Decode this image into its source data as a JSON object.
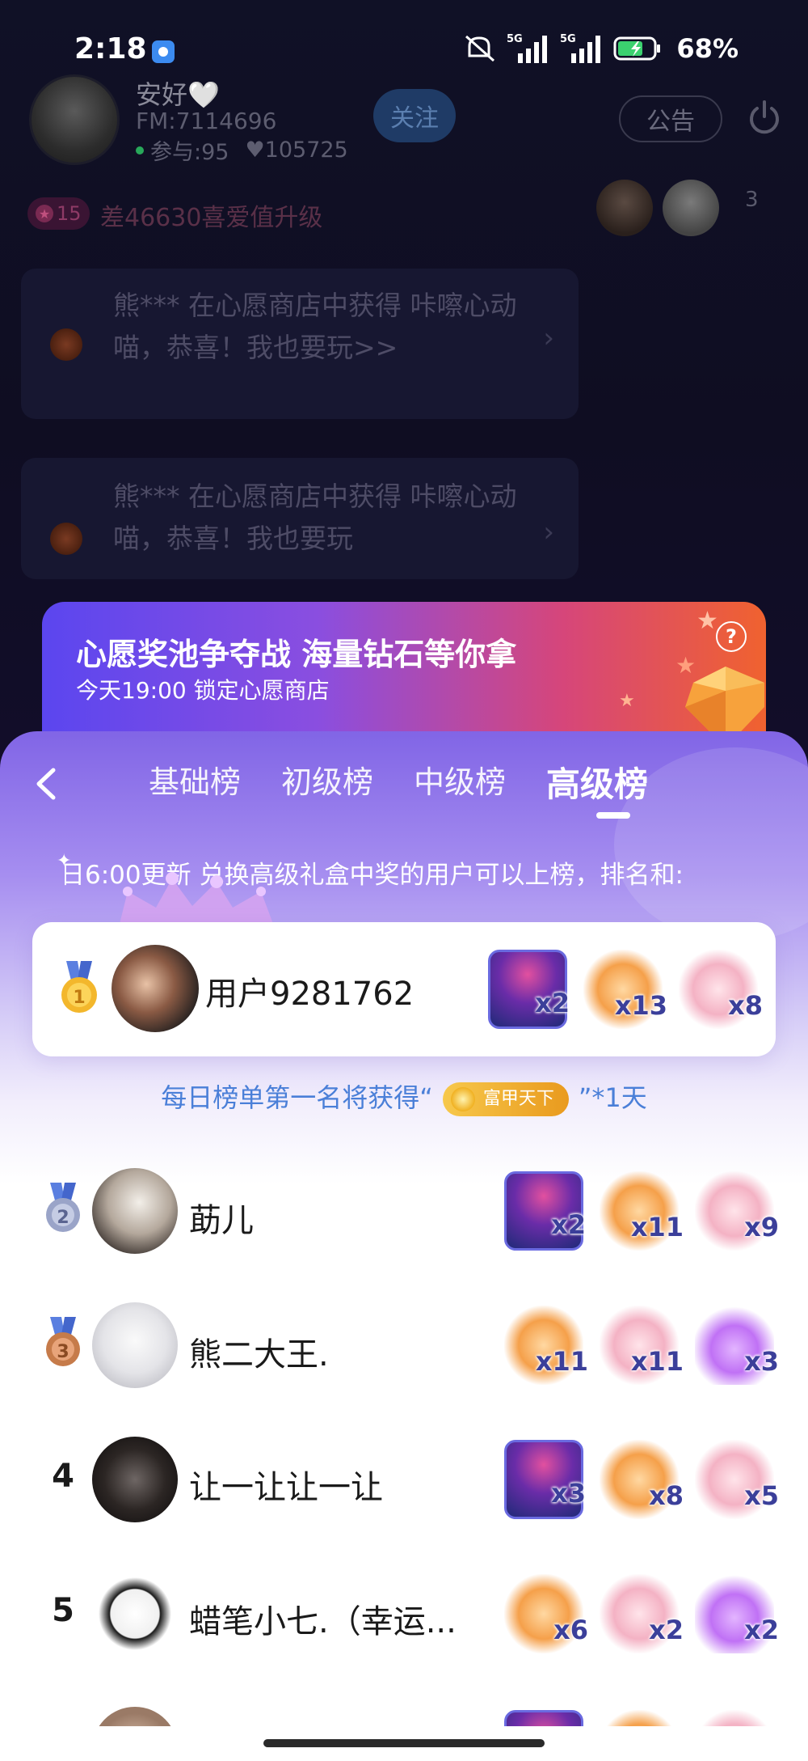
{
  "status_bar": {
    "time": "2:18",
    "network_1": "5G",
    "network_2": "5G",
    "battery": "68%"
  },
  "room": {
    "host_name": "安好🤍",
    "host_fm": "FM:7114696",
    "host_participants": "参与:95",
    "host_likes": "♥105725",
    "follow_label": "关注",
    "notice_label": "公告",
    "level_number": "15",
    "level_text": "差46630喜爱值升级",
    "audience_count": "3",
    "messages": [
      {
        "text": "熊*** 在心愿商店中获得 咔嚓心动喵，恭喜！我也要玩>>"
      },
      {
        "text": "熊*** 在心愿商店中获得 咔嚓心动喵，恭喜！我也要玩"
      }
    ]
  },
  "promo": {
    "title": "心愿奖池争夺战 海量钻石等你拿",
    "subtitle": "今天19:00 锁定心愿商店",
    "help": "?"
  },
  "leaderboard": {
    "tabs": [
      {
        "label": "基础榜",
        "active": false
      },
      {
        "label": "初级榜",
        "active": false
      },
      {
        "label": "中级榜",
        "active": false
      },
      {
        "label": "高级榜",
        "active": true
      }
    ],
    "ticker": "日6:00更新 兑换高级礼盒中奖的用户可以上榜，排名和:",
    "reward_prefix": "每日榜单第一名将获得“",
    "reward_badge": "富甲天下",
    "reward_suffix": "”*1天",
    "entries": [
      {
        "rank": "1",
        "name": "用户9281762",
        "medal": "gold",
        "gifts": [
          {
            "icon": "dj-girl",
            "count": "x2"
          },
          {
            "icon": "camera-cat",
            "count": "x13"
          },
          {
            "icon": "angel-bear",
            "count": "x8"
          }
        ]
      },
      {
        "rank": "2",
        "name": "莇儿",
        "medal": "silver",
        "gifts": [
          {
            "icon": "dj-girl",
            "count": "x2"
          },
          {
            "icon": "camera-cat",
            "count": "x11"
          },
          {
            "icon": "angel-bear",
            "count": "x9"
          }
        ]
      },
      {
        "rank": "3",
        "name": "熊二大王.",
        "medal": "bronze",
        "gifts": [
          {
            "icon": "camera-cat",
            "count": "x11"
          },
          {
            "icon": "angel-bear",
            "count": "x11"
          },
          {
            "icon": "cupid-heart",
            "count": "x3"
          }
        ]
      },
      {
        "rank": "4",
        "name": "让一让让一让",
        "medal": "none",
        "gifts": [
          {
            "icon": "dj-girl",
            "count": "x3"
          },
          {
            "icon": "camera-cat",
            "count": "x8"
          },
          {
            "icon": "angel-bear",
            "count": "x5"
          }
        ]
      },
      {
        "rank": "5",
        "name": "蜡笔小七.（幸运...",
        "medal": "none",
        "gifts": [
          {
            "icon": "camera-cat",
            "count": "x6"
          },
          {
            "icon": "angel-bear",
            "count": "x2"
          },
          {
            "icon": "cupid-heart",
            "count": "x2"
          }
        ]
      }
    ]
  }
}
